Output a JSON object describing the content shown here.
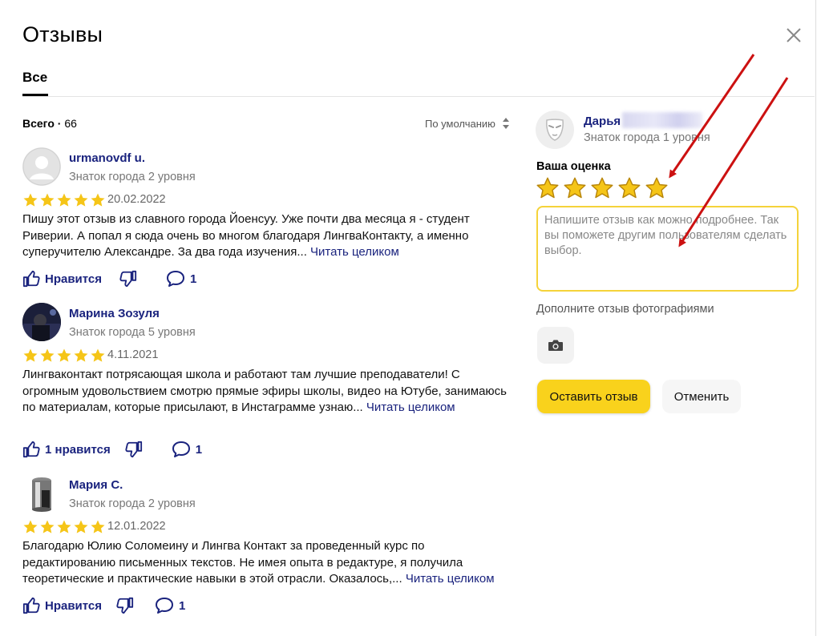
{
  "header": {
    "title": "Отзывы",
    "close_icon": "close-icon"
  },
  "tabs": [
    {
      "label": "Все",
      "active": true
    }
  ],
  "summary": {
    "total_label": "Всего",
    "total_sep": " · ",
    "total_count": "66",
    "sort_label": "По умолчанию"
  },
  "reviews": [
    {
      "name": "urmanovdf u.",
      "level": "Знаток города 2 уровня",
      "rating": 5,
      "date": "20.02.2022",
      "text": "Пишу этот отзыв из славного города Йоенсуу. Уже почти два месяца я - студент Риверии. А попал я сюда очень во многом благодаря ЛингваКонтакту, а именно суперучителю Александре. За два года изучения...",
      "read_more": "Читать целиком",
      "like_label": "Нравится",
      "comments": "1"
    },
    {
      "name": "Марина Зозуля",
      "level": "Знаток города 5 уровня",
      "rating": 5,
      "date": "4.11.2021",
      "text": "Лингваконтакт потрясающая школа и работают там лучшие преподаватели! С огромным удовольствием смотрю прямые эфиры школы, видео на Ютубе, занимаюсь по материалам, которые присылают, в Инстаграмме узнаю...",
      "read_more": "Читать целиком",
      "like_label": "1 нравится",
      "comments": "1"
    },
    {
      "name": "Мария С.",
      "level": "Знаток города 2 уровня",
      "rating": 5,
      "date": "12.01.2022",
      "text": "Благодарю Юлию Соломеину и Лингва Контакт за проведенный курс по редактированию письменных текстов. Не имея опыта в редактуре, я получила теоретические и практические навыки в этой отрасли. Оказалось,...",
      "read_more": "Читать целиком",
      "like_label": "Нравится",
      "comments": "1"
    }
  ],
  "my_review": {
    "name": "Дарья",
    "level": "Знаток города 1 уровня",
    "rating_label": "Ваша оценка",
    "rating": 5,
    "placeholder": "Напишите отзыв как можно подробнее. Так вы поможете другим пользователям сделать выбор.",
    "photo_label": "Дополните отзыв фотографиями",
    "submit_label": "Оставить отзыв",
    "cancel_label": "Отменить"
  },
  "colors": {
    "accent": "#f9d21c",
    "star": "#f5c518",
    "link": "#1a237e",
    "annotation_arrow": "#cc1111"
  },
  "icons": {
    "like": "thumbs-up-icon",
    "dislike": "thumbs-down-icon",
    "comment": "comment-icon",
    "camera": "camera-icon",
    "sort": "sort-arrows-icon"
  }
}
